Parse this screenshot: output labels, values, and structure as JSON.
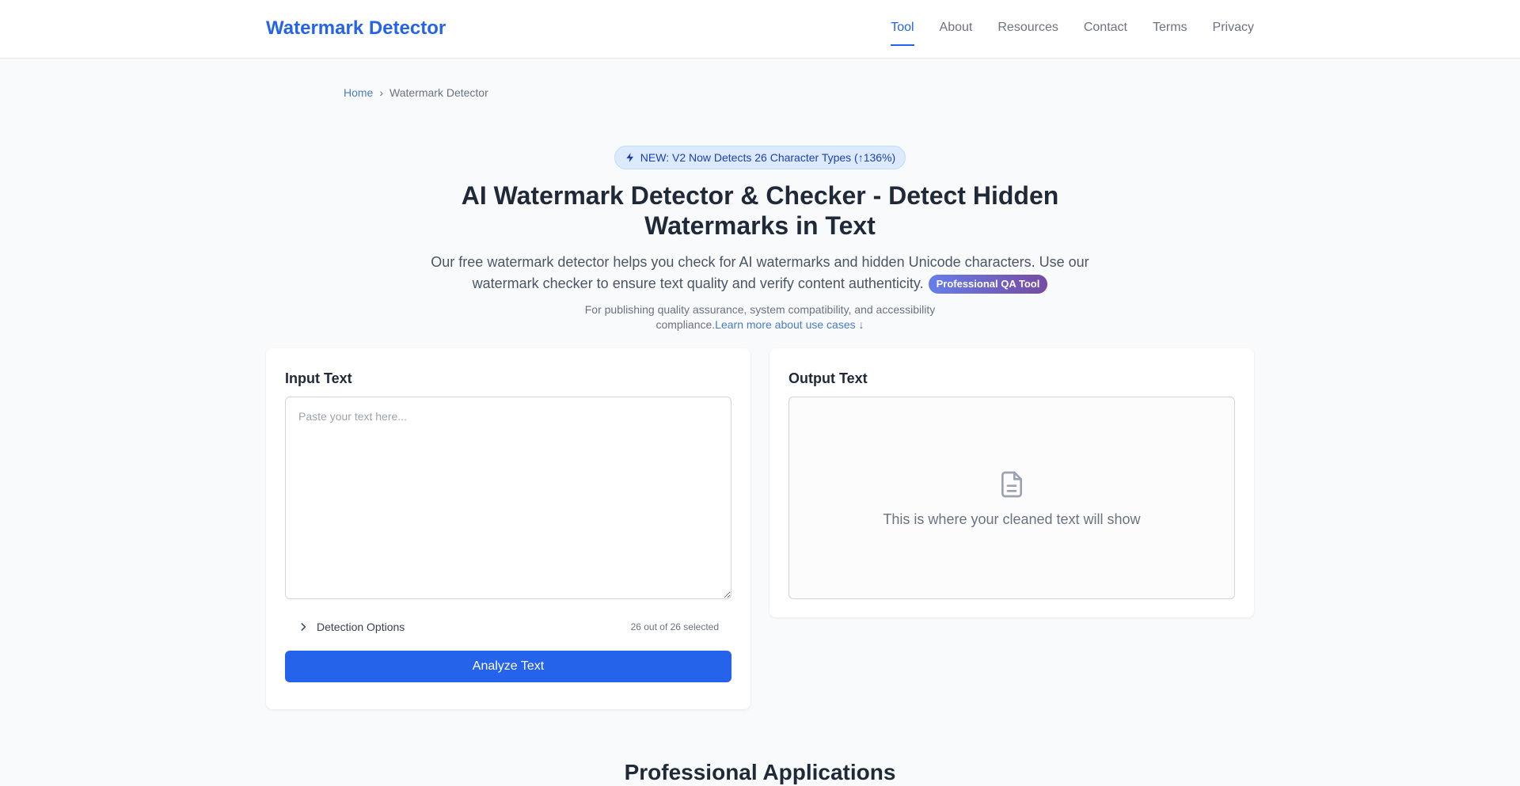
{
  "header": {
    "brand": "Watermark Detector",
    "nav": [
      "Tool",
      "About",
      "Resources",
      "Contact",
      "Terms",
      "Privacy"
    ],
    "active_nav": "Tool",
    "accent_color": "#2563eb"
  },
  "breadcrumb": {
    "home": "Home",
    "separator": "›",
    "current": "Watermark Detector"
  },
  "hero": {
    "badge_icon": "lightning-icon",
    "badge": "NEW: V2 Now Detects 26 Character Types (↑136%)",
    "title": "AI Watermark Detector & Checker - Detect Hidden Watermarks in Text",
    "description": "Our free watermark detector helps you check for AI watermarks and hidden Unicode characters. Use our watermark checker to ensure text quality and verify content authenticity.",
    "pro_badge": "Professional QA Tool",
    "note": "For publishing quality assurance, system compatibility, and accessibility compliance.",
    "note_link": "Learn more about use cases ↓"
  },
  "input_panel": {
    "title": "Input Text",
    "placeholder": "Paste your text here...",
    "value": "",
    "options_icon": "chevron-right-icon",
    "options_label": "Detection Options",
    "options_count": "26 out of 26 selected",
    "analyze_label": "Analyze Text"
  },
  "output_panel": {
    "title": "Output Text",
    "icon": "document-icon",
    "placeholder": "This is where your cleaned text will show"
  },
  "sections": {
    "applications_title": "Professional Applications"
  }
}
